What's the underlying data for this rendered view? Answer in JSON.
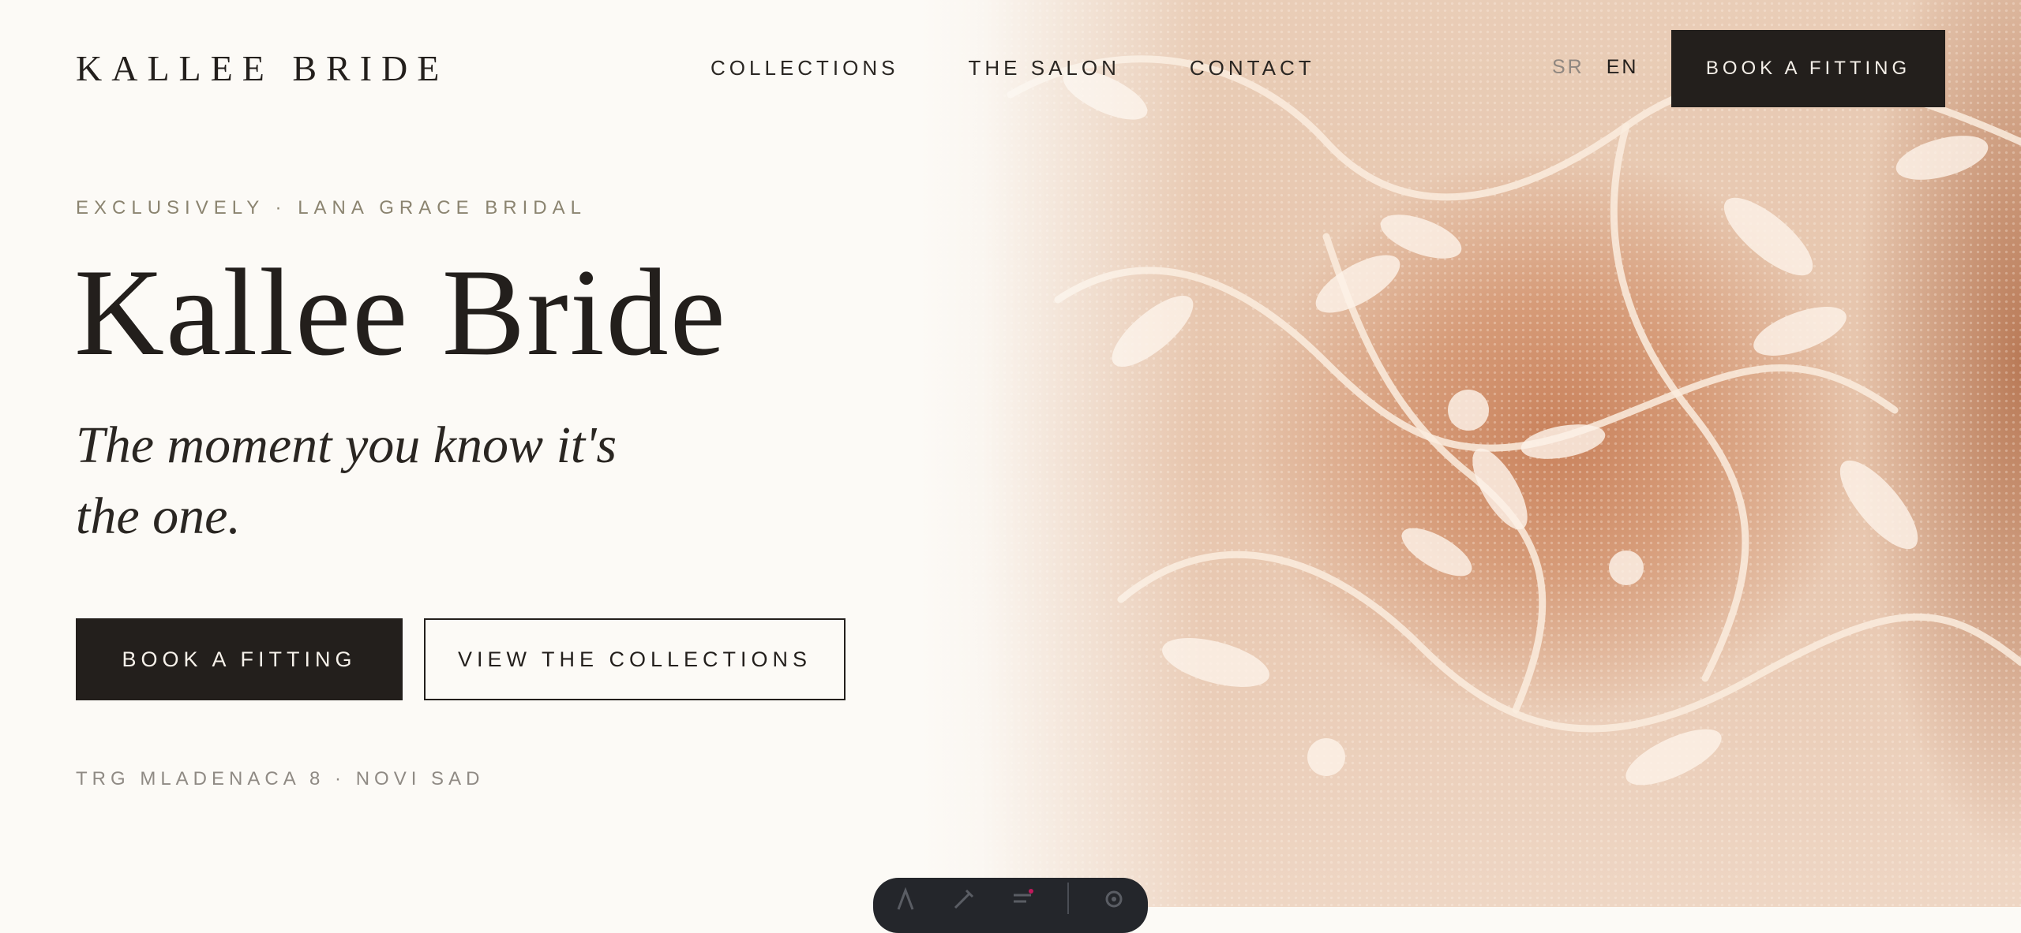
{
  "header": {
    "brand": "KALLEE BRIDE",
    "nav": [
      "COLLECTIONS",
      "THE SALON",
      "CONTACT"
    ],
    "languages": {
      "sr": "SR",
      "en": "EN",
      "active": "EN"
    },
    "cta_label": "BOOK A FITTING"
  },
  "hero": {
    "eyebrow": "EXCLUSIVELY · LANA GRACE BRIDAL",
    "title": "Kallee Bride",
    "tagline_line1": "The moment you know it's",
    "tagline_line2": "the one.",
    "primary_button": "BOOK A FITTING",
    "secondary_button": "VIEW THE COLLECTIONS",
    "address": "TRG MLADENACA 8 · NOVI SAD"
  },
  "dock": {
    "icons": [
      "text-tool-icon",
      "pen-tool-icon",
      "list-tool-icon",
      "settings-icon"
    ]
  },
  "colors": {
    "background": "#fcfaf6",
    "ink": "#231f1c",
    "eyebrow": "#8b8470",
    "muted": "#8f8a84",
    "lace_skin": "#c9825c"
  }
}
